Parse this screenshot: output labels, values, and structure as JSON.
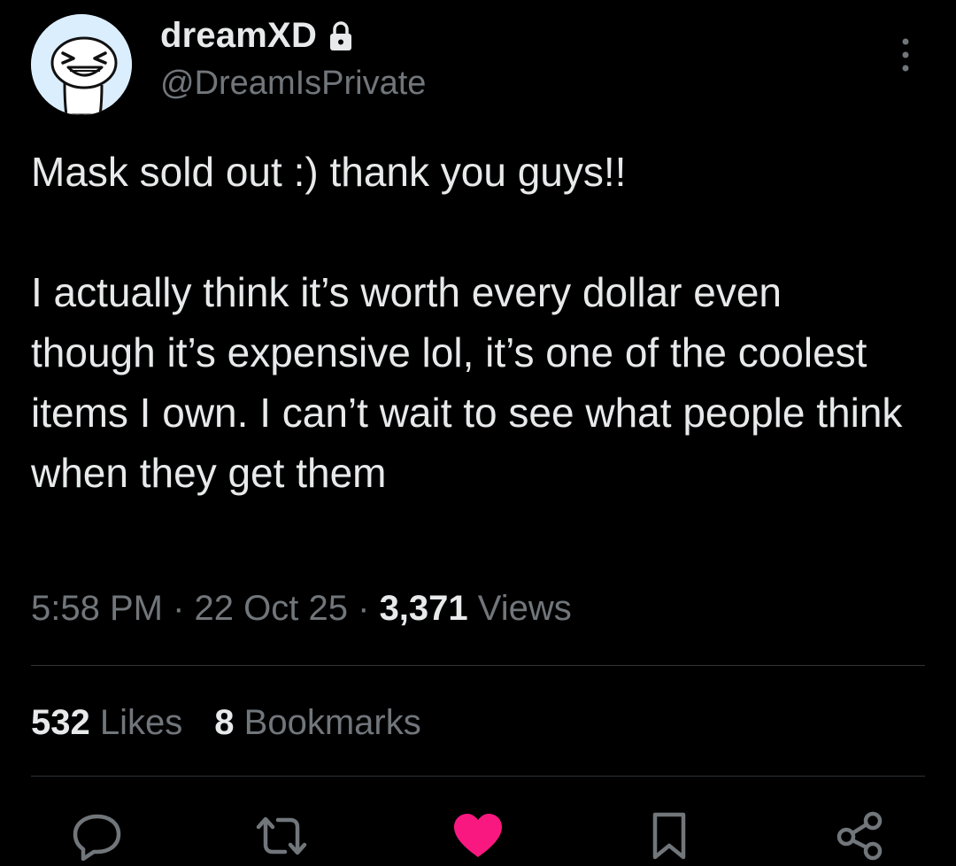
{
  "tweet": {
    "author": {
      "display_name": "dreamXD",
      "handle": "@DreamIsPrivate",
      "avatar_icon": "smiling-mask-avatar",
      "protected_icon": "lock-icon"
    },
    "text": "Mask sold out :) thank you guys!!\n\nI actually think it’s worth every dollar even though it’s expensive lol, it’s one of the coolest items I own. I can’t wait to see what people think when they get them",
    "time": "5:58 PM",
    "date": "22 Oct 25",
    "separator": "·",
    "views_count": "3,371",
    "views_label": "Views",
    "likes_count": "532",
    "likes_label": "Likes",
    "bookmarks_count": "8",
    "bookmarks_label": "Bookmarks"
  },
  "actions": {
    "reply_icon": "reply-icon",
    "retweet_icon": "retweet-icon",
    "like_icon": "heart-icon",
    "like_active": true,
    "bookmark_icon": "bookmark-icon",
    "share_icon": "share-icon"
  },
  "colors": {
    "background": "#000000",
    "text_primary": "#e7e9ea",
    "text_secondary": "#71767b",
    "divider": "#2f3336",
    "like_active": "#f91880"
  }
}
